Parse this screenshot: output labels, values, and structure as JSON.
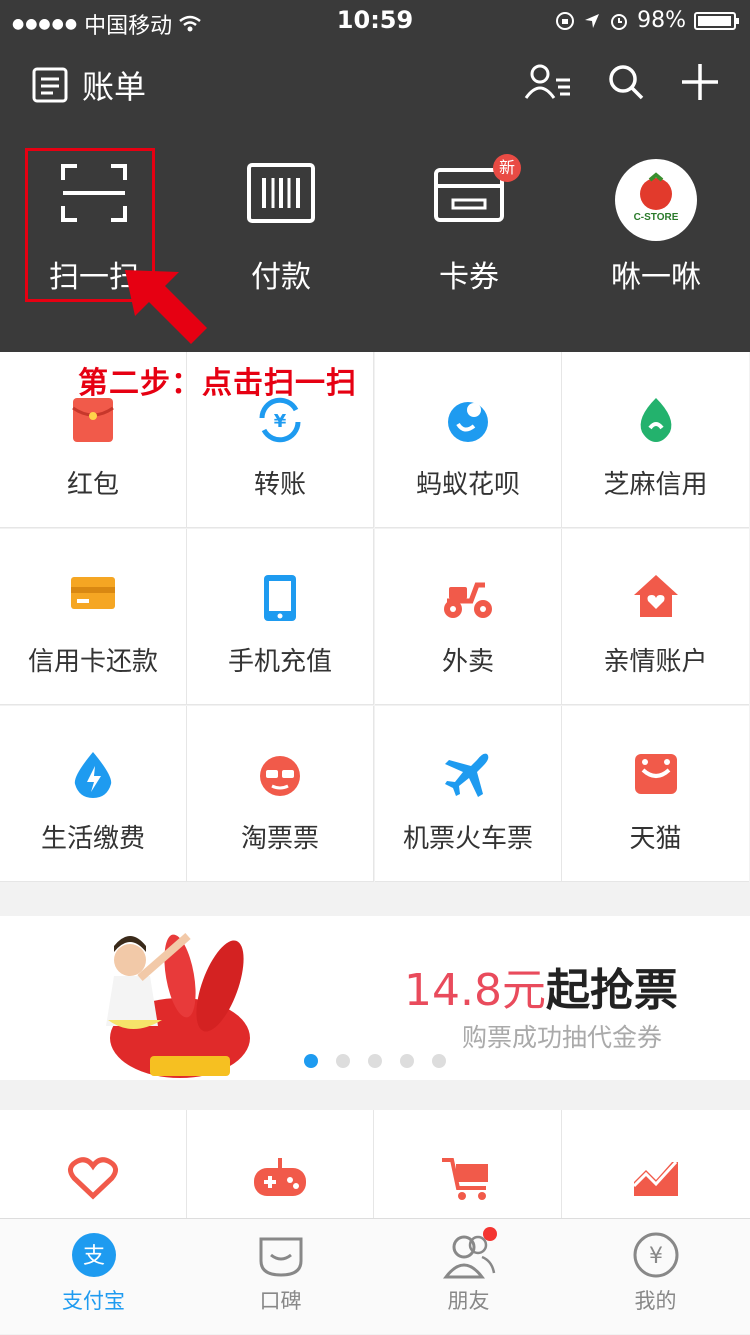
{
  "status_bar": {
    "carrier": "中国移动",
    "time": "10:59",
    "battery": "98%",
    "battery_level": 0.98
  },
  "header": {
    "bill_label": "账单"
  },
  "quick_actions": [
    {
      "label": "扫一扫",
      "icon": "scan-icon"
    },
    {
      "label": "付款",
      "icon": "barcode-icon"
    },
    {
      "label": "卡券",
      "icon": "wallet-icon",
      "badge": "新"
    },
    {
      "label": "咻一咻",
      "icon": "cstore-icon",
      "logo_text": "C-STORE"
    }
  ],
  "annotation": {
    "text": "第二步：点击扫一扫"
  },
  "services": [
    {
      "label": "红包",
      "icon": "red-envelope-icon",
      "color": "#f15a4a"
    },
    {
      "label": "转账",
      "icon": "transfer-icon",
      "color": "#1e9bf0"
    },
    {
      "label": "蚂蚁花呗",
      "icon": "huabei-icon",
      "color": "#1e9bf0"
    },
    {
      "label": "芝麻信用",
      "icon": "sesame-credit-icon",
      "color": "#23b26d"
    },
    {
      "label": "信用卡还款",
      "icon": "credit-card-icon",
      "color": "#f5a623"
    },
    {
      "label": "手机充值",
      "icon": "phone-icon",
      "color": "#1e9bf0"
    },
    {
      "label": "外卖",
      "icon": "scooter-icon",
      "color": "#f15a4a"
    },
    {
      "label": "亲情账户",
      "icon": "family-home-icon",
      "color": "#f15a4a"
    },
    {
      "label": "生活缴费",
      "icon": "utility-drop-icon",
      "color": "#1e9bf0"
    },
    {
      "label": "淘票票",
      "icon": "taopiaopiao-icon",
      "color": "#f15a4a"
    },
    {
      "label": "机票火车票",
      "icon": "airplane-icon",
      "color": "#1e9bf0"
    },
    {
      "label": "天猫",
      "icon": "tmall-icon",
      "color": "#f15a4a"
    }
  ],
  "banner": {
    "price_text": "14.8元",
    "title_text": "起抢票",
    "subtitle": "购票成功抽代金券",
    "page_count": 5,
    "active_page": 1
  },
  "more_services": [
    {
      "icon": "heart-hands-icon"
    },
    {
      "icon": "gamepad-icon"
    },
    {
      "icon": "shopping-cart-icon"
    },
    {
      "icon": "stock-chart-icon"
    }
  ],
  "tabbar": [
    {
      "label": "支付宝",
      "icon": "alipay-icon",
      "glyph": "支",
      "active": true
    },
    {
      "label": "口碑",
      "icon": "koubei-icon",
      "active": false
    },
    {
      "label": "朋友",
      "icon": "friends-icon",
      "active": false,
      "has_dot": true
    },
    {
      "label": "我的",
      "icon": "profile-yen-icon",
      "glyph": "¥",
      "active": false
    }
  ],
  "colors": {
    "header_bg": "#3a3a3a",
    "accent_blue": "#1e9bf0",
    "annotation_red": "#e60012"
  }
}
